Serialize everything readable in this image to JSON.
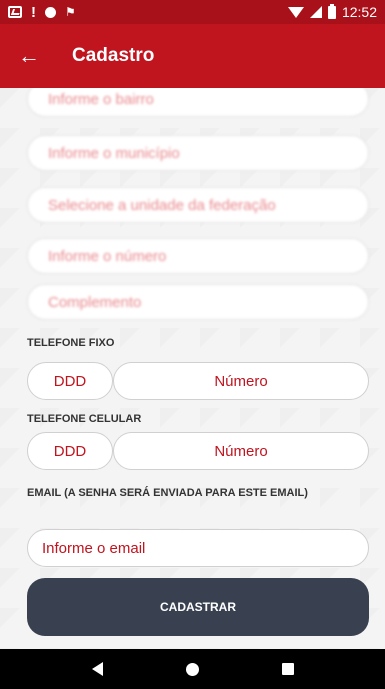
{
  "status_bar": {
    "time": "12:52",
    "icons": [
      "gallery-icon",
      "alert-icon",
      "record-icon",
      "flag-icon",
      "wifi-icon",
      "signal-icon",
      "battery-icon"
    ]
  },
  "app_bar": {
    "back_icon": "arrow-left-icon",
    "title": "Cadastro"
  },
  "form": {
    "address_placeholders": [
      "Informe o bairro",
      "Informe o município",
      "Selecione a unidade da federação",
      "Informe o número",
      "Complemento"
    ],
    "telefone_fixo": {
      "label": "TELEFONE FIXO",
      "ddd_placeholder": "DDD",
      "numero_placeholder": "Número"
    },
    "telefone_celular": {
      "label": "TELEFONE CELULAR",
      "ddd_placeholder": "DDD",
      "numero_placeholder": "Número"
    },
    "email": {
      "label": "EMAIL (A SENHA SERÁ ENVIADA PARA ESTE EMAIL)",
      "placeholder": "Informe o email"
    },
    "submit_label": "CADASTRAR"
  },
  "colors": {
    "status_bar": "#a8111a",
    "app_bar": "#c0141f",
    "accent_text": "#c0141f",
    "submit_button": "#394151",
    "nav_bar": "#000000"
  },
  "nav_bar": {
    "icons": [
      "back-triangle-icon",
      "home-circle-icon",
      "recents-square-icon"
    ]
  }
}
